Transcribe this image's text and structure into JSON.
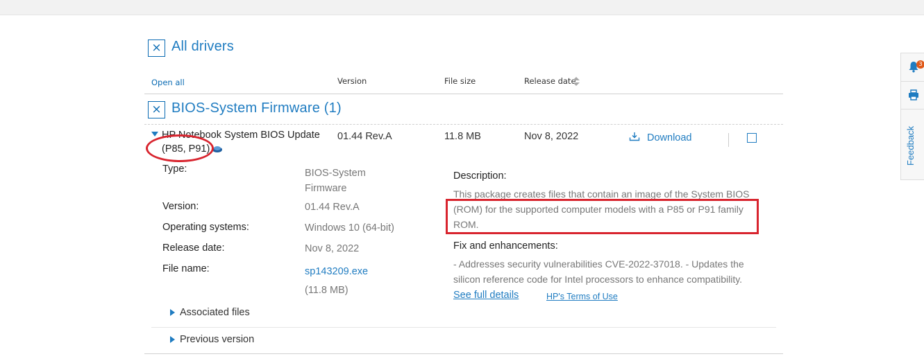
{
  "header": {
    "all_drivers_title": "All drivers",
    "close_glyph": "×"
  },
  "columns": {
    "open_all": "Open all",
    "version": "Version",
    "file_size": "File size",
    "release_date": "Release date"
  },
  "category": {
    "title": "BIOS-System Firmware (1)"
  },
  "driver": {
    "name_line1": "HP Notebook System BIOS Update",
    "name_line2": "(P85, P91)",
    "version": "01.44 Rev.A",
    "file_size": "11.8 MB",
    "release_date": "Nov 8, 2022",
    "download_label": "Download",
    "details": {
      "type_label": "Type:",
      "type_value_line1": "BIOS-System",
      "type_value_line2": "Firmware",
      "version_label": "Version:",
      "version_value": "01.44 Rev.A",
      "os_label": "Operating systems:",
      "os_value": "Windows 10 (64-bit)",
      "release_label": "Release date:",
      "release_value": "Nov 8, 2022",
      "file_label": "File name:",
      "file_value": "sp143209.exe",
      "file_size_value": "(11.8 MB)"
    },
    "description_label": "Description:",
    "description_line1": "This package creates files that contain an image of the System BIOS",
    "description_line2": "(ROM) for the supported computer models with a P85 or P91 family",
    "description_line3": "ROM.",
    "fixes_label": "Fix and enhancements:",
    "fixes_line1": "- Addresses security vulnerabilities CVE-2022-37018. - Updates the",
    "fixes_line2": "silicon reference code for Intel processors to enhance compatibility.",
    "see_full_details": "See full details",
    "terms_of_use": "HP's Terms of Use",
    "associated_files": "Associated files",
    "previous_version": "Previous version"
  },
  "side_panel": {
    "notification_count": "3",
    "feedback_label": "Feedback"
  },
  "colors": {
    "accent": "#1f7cc1",
    "annotation_red": "#d8242e"
  }
}
